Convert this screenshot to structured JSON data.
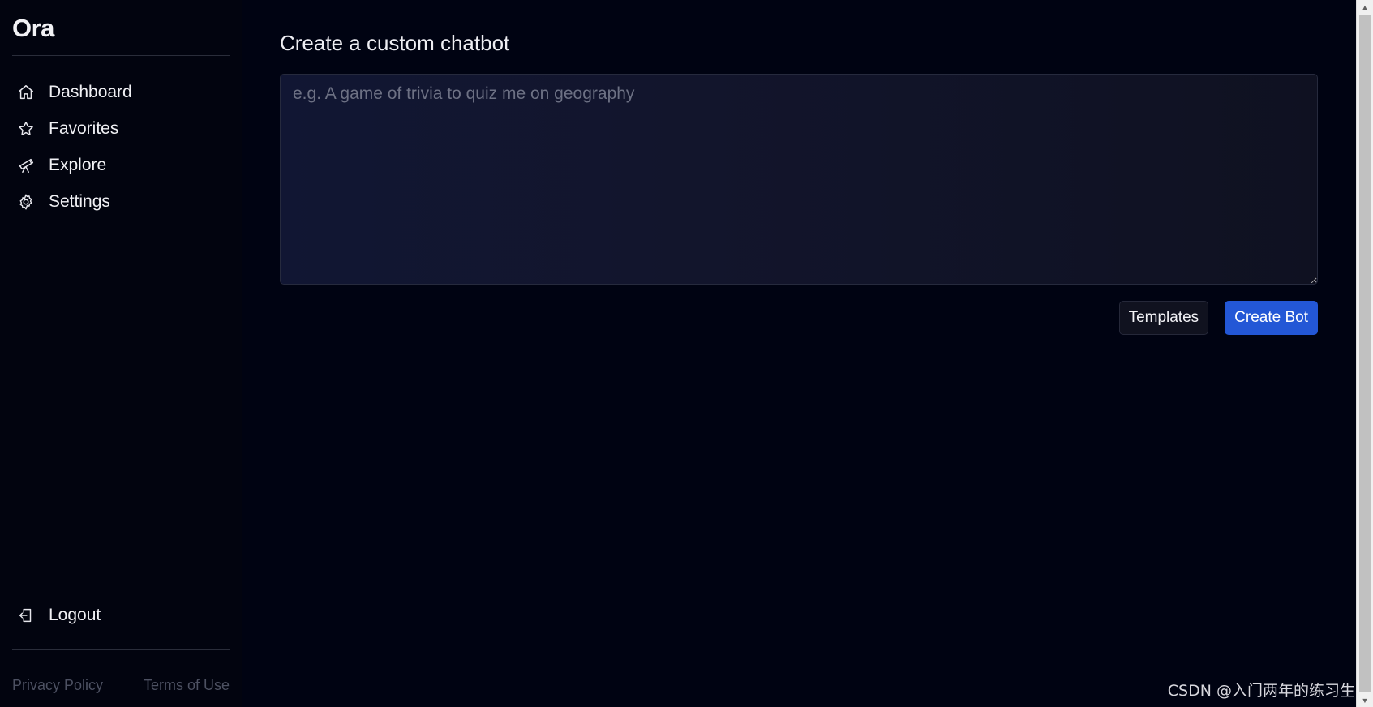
{
  "sidebar": {
    "brand": "Ora",
    "nav": [
      {
        "label": "Dashboard",
        "icon": "home-icon"
      },
      {
        "label": "Favorites",
        "icon": "star-icon"
      },
      {
        "label": "Explore",
        "icon": "telescope-icon"
      },
      {
        "label": "Settings",
        "icon": "gear-icon"
      }
    ],
    "logout": {
      "label": "Logout",
      "icon": "logout-icon"
    },
    "footer": {
      "privacy": "Privacy Policy",
      "terms": "Terms of Use"
    }
  },
  "main": {
    "title": "Create a custom chatbot",
    "prompt": {
      "placeholder": "e.g. A game of trivia to quiz me on geography",
      "value": ""
    },
    "buttons": {
      "templates": "Templates",
      "create": "Create Bot"
    }
  },
  "watermark": "CSDN @入门两年的练习生",
  "colors": {
    "background": "#000312",
    "accent": "#2357d6"
  }
}
